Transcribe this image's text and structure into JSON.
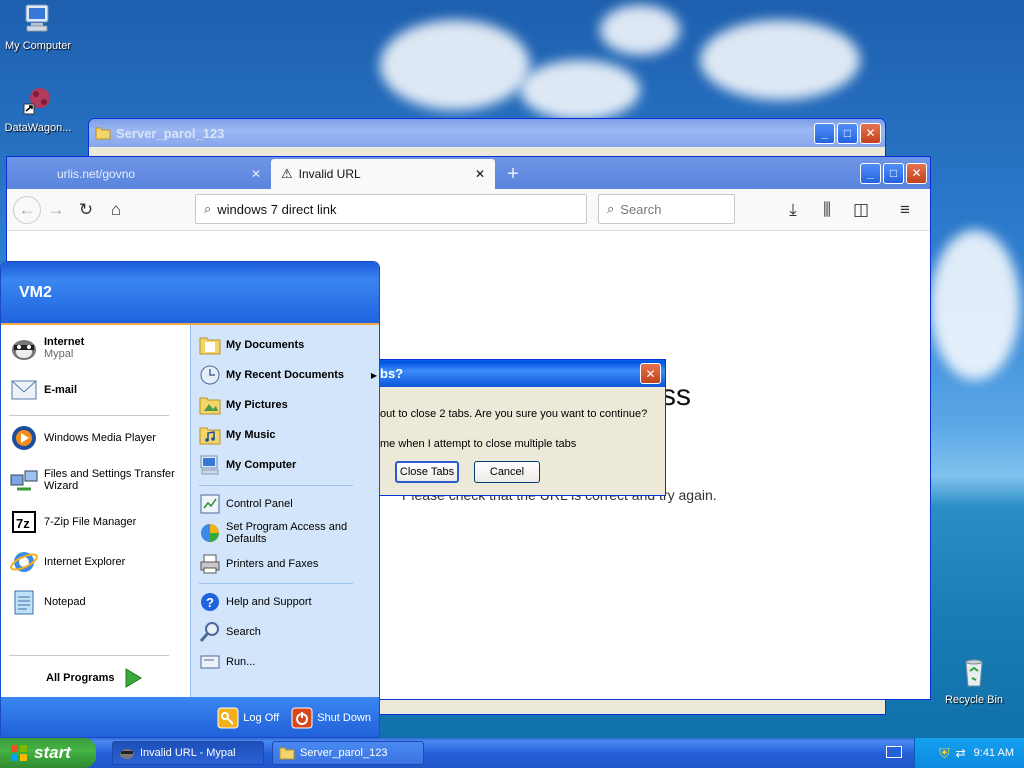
{
  "desktop": {
    "icons": [
      {
        "label": "My Computer"
      },
      {
        "label": "DataWagon..."
      },
      {
        "label": "Recycle Bin"
      }
    ]
  },
  "explorer_window": {
    "title": "Server_parol_123"
  },
  "browser": {
    "tabs": [
      {
        "label": "urlis.net/govno"
      },
      {
        "label": "Invalid URL"
      }
    ],
    "url_value": "windows 7 direct link",
    "search_placeholder": "Search",
    "page_heading_fragment": "ss",
    "page_message": "Please check that the URL is correct and try again."
  },
  "dialog": {
    "title_fragment": "bs?",
    "message": "out to close 2 tabs. Are you sure you want to continue?",
    "checkbox_label": "me when I attempt to close multiple tabs",
    "close_tabs_button": "Close Tabs",
    "cancel_button": "Cancel"
  },
  "start_menu": {
    "user_name": "VM2",
    "pinned": [
      {
        "label": "Internet",
        "sub": "Mypal"
      },
      {
        "label": "E-mail"
      }
    ],
    "recent": [
      {
        "label": "Windows Media Player"
      },
      {
        "label": "Files and Settings Transfer Wizard"
      },
      {
        "label": "7-Zip File Manager"
      },
      {
        "label": "Internet Explorer"
      },
      {
        "label": "Notepad"
      }
    ],
    "all_programs": "All Programs",
    "places": [
      {
        "label": "My Documents"
      },
      {
        "label": "My Recent Documents"
      },
      {
        "label": "My Pictures"
      },
      {
        "label": "My Music"
      },
      {
        "label": "My Computer"
      }
    ],
    "settings": [
      {
        "label": "Control Panel"
      },
      {
        "label": "Set Program Access and Defaults"
      },
      {
        "label": "Printers and Faxes"
      }
    ],
    "tools": [
      {
        "label": "Help and Support"
      },
      {
        "label": "Search"
      },
      {
        "label": "Run..."
      }
    ],
    "log_off": "Log Off",
    "shut_down": "Shut Down"
  },
  "taskbar": {
    "start_label": "start",
    "tasks": [
      {
        "label": "Invalid URL - Mypal"
      },
      {
        "label": "Server_parol_123"
      }
    ],
    "clock": "9:41 AM"
  }
}
